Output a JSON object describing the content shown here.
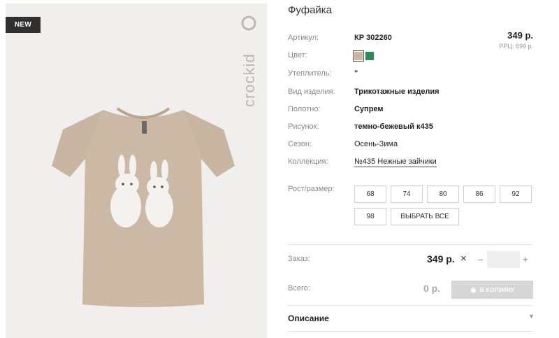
{
  "product": {
    "title": "Фуфайка",
    "badge": "NEW",
    "brand_logo_text": "crockid",
    "colors": {
      "beige": "#c9b7a1",
      "green": "#2e8b57",
      "badge_bg": "#303030"
    }
  },
  "price": {
    "main": "349 р.",
    "rrp": "РРЦ: 699 р."
  },
  "attributes": [
    {
      "label": "Артикул:",
      "value": "КР 302260"
    },
    {
      "label": "Цвет:",
      "value": ""
    },
    {
      "label": "Утеплитель:",
      "value": "\""
    },
    {
      "label": "Вид изделия:",
      "value": "Трикотажные изделия"
    },
    {
      "label": "Полотно:",
      "value": "Супрем"
    },
    {
      "label": "Рисунок:",
      "value": "темно-бежевый к435"
    },
    {
      "label": "Сезон:",
      "value": "Осень-Зима"
    },
    {
      "label": "Коллекция:",
      "value": "№435 Нежные зайчики"
    }
  ],
  "sizes": {
    "label": "Рост/размер:",
    "options": [
      "68",
      "74",
      "80",
      "86",
      "92",
      "98"
    ],
    "select_all": "ВЫБРАТЬ ВСЕ"
  },
  "order": {
    "label": "Заказ:",
    "price": "349 р.",
    "times": "×",
    "minus": "–",
    "plus": "+",
    "quantity": ""
  },
  "total": {
    "label": "Всего:",
    "value": "0 р.",
    "cart_button": "В КОРЗИНУ"
  },
  "description": {
    "label": "Описание",
    "arrow": "▼"
  }
}
